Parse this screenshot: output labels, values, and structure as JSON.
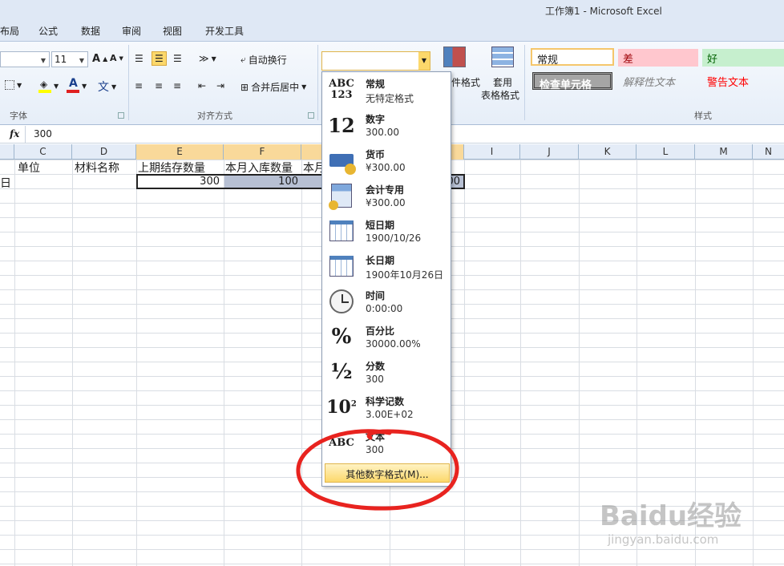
{
  "window": {
    "title": "工作簿1 - Microsoft Excel"
  },
  "tabs": [
    "布局",
    "公式",
    "数据",
    "审阅",
    "视图",
    "开发工具"
  ],
  "ribbon": {
    "font_size": "11",
    "font_group_label": "字体",
    "align_group_label": "对齐方式",
    "wrap_text": "自动换行",
    "merge_center": "合并后居中",
    "cond_format_label": "件格式",
    "table_format_line1": "套用",
    "table_format_line2": "表格格式",
    "styles_group_label": "样式",
    "styles": {
      "normal": "常规",
      "bad": "差",
      "good": "好",
      "check_cell": "检查单元格",
      "explanatory": "解释性文本",
      "warning": "警告文本"
    },
    "number_format_value": ""
  },
  "formula_bar": {
    "fx": "fx",
    "value": "300"
  },
  "columns": [
    "C",
    "D",
    "E",
    "F",
    "",
    "",
    "I",
    "J",
    "K",
    "L",
    "M",
    "N"
  ],
  "row1": {
    "b": "单位",
    "a_partial": "日",
    "d": "材料名称",
    "e": "上期结存数量",
    "f": "本月入库数量",
    "g_partial": "本月"
  },
  "row2": {
    "e": "300",
    "f": "100",
    "h_partial": "00"
  },
  "number_formats": [
    {
      "name": "常规",
      "sample": "无特定格式",
      "icon": "abc-123-icon"
    },
    {
      "name": "数字",
      "sample": "300.00",
      "icon": "number-12-icon"
    },
    {
      "name": "货币",
      "sample": "¥300.00",
      "icon": "currency-icon"
    },
    {
      "name": "会计专用",
      "sample": "¥300.00",
      "icon": "accounting-icon"
    },
    {
      "name": "短日期",
      "sample": "1900/10/26",
      "icon": "calendar-short-icon"
    },
    {
      "name": "长日期",
      "sample": "1900年10月26日",
      "icon": "calendar-long-icon"
    },
    {
      "name": "时间",
      "sample": "0:00:00",
      "icon": "clock-icon"
    },
    {
      "name": "百分比",
      "sample": "30000.00%",
      "icon": "percent-icon"
    },
    {
      "name": "分数",
      "sample": "300",
      "icon": "fraction-icon"
    },
    {
      "name": "科学记数",
      "sample": "3.00E+02",
      "icon": "scientific-icon"
    },
    {
      "name": "文本",
      "sample": "300",
      "icon": "abc-text-icon"
    }
  ],
  "more_formats": "其他数字格式(M)...",
  "watermark": {
    "main": "Baidu经验",
    "sub": "jingyan.baidu.com"
  }
}
